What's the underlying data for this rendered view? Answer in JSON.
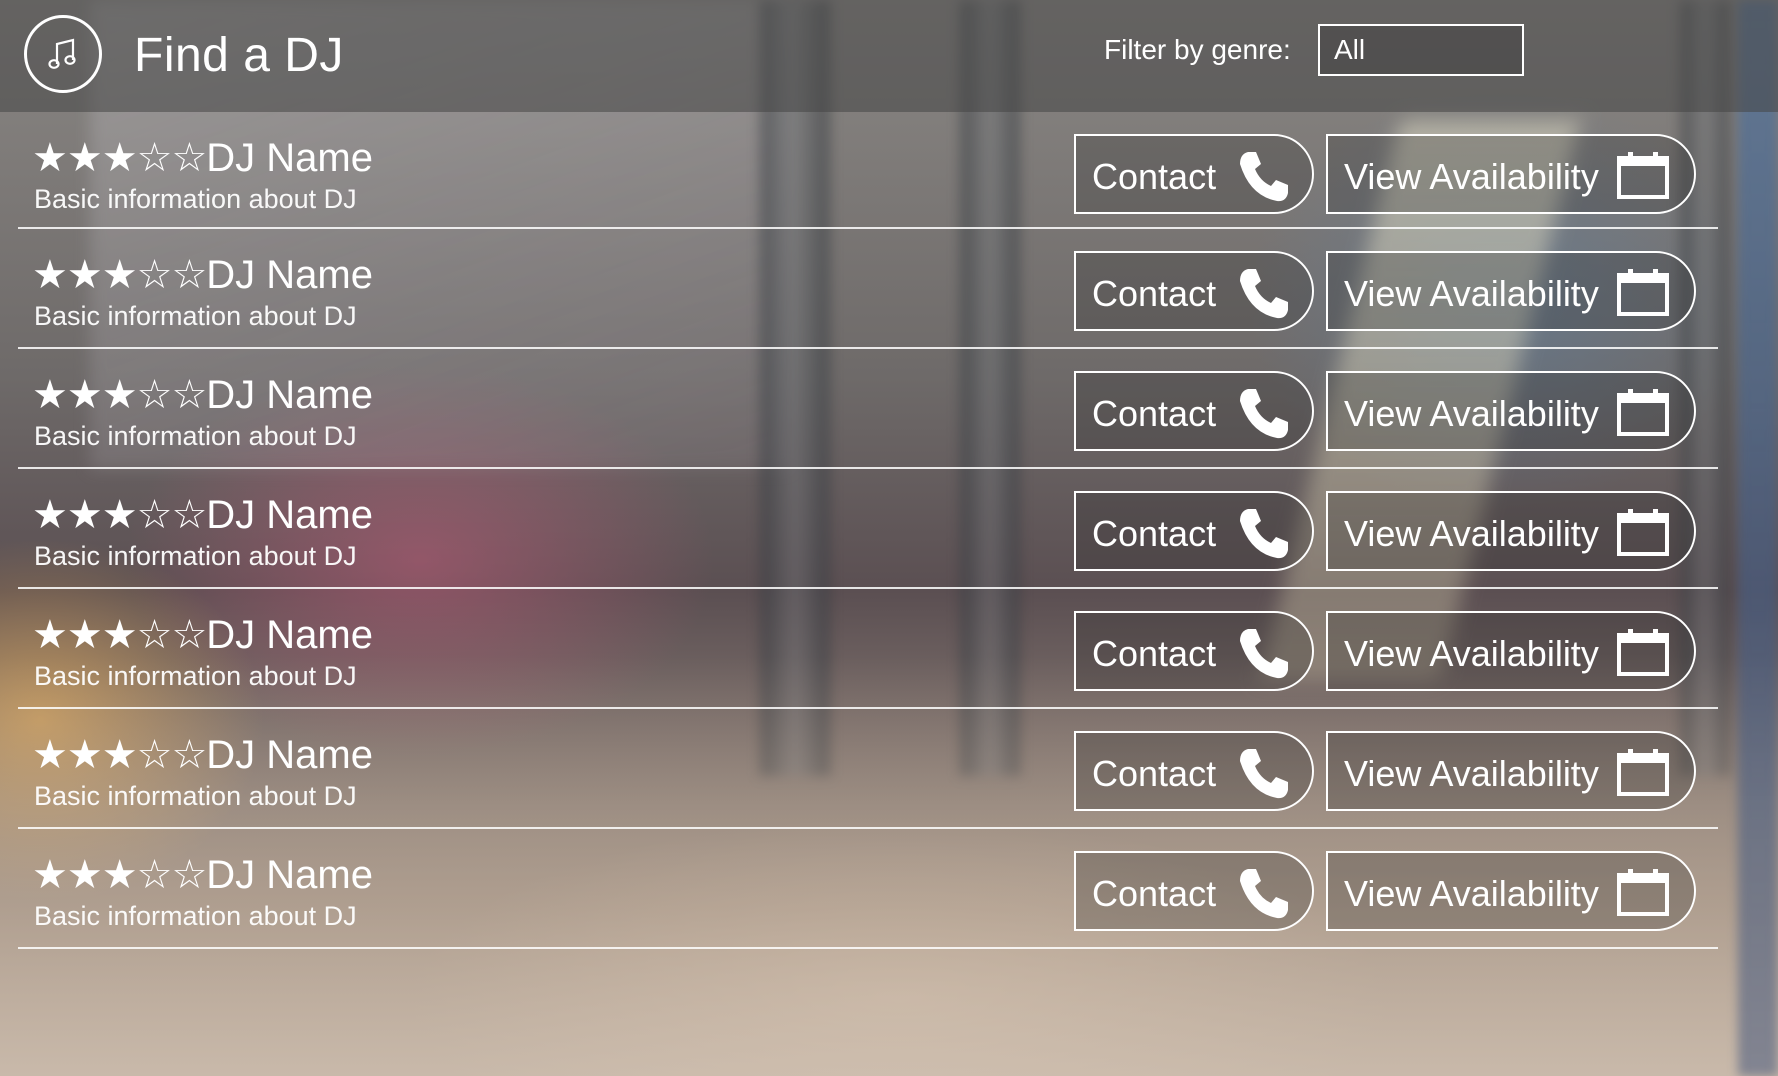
{
  "header": {
    "title": "Find a DJ",
    "logo_icon": "music-note-icon",
    "filter_label": "Filter by genre:",
    "filter_value": "All"
  },
  "djs": [
    {
      "rating_stars": "★★★☆☆",
      "rating": 3,
      "name": "DJ Name",
      "info": "Basic information about DJ",
      "contact_label": "Contact",
      "availability_label": "View Availability"
    },
    {
      "rating_stars": "★★★☆☆",
      "rating": 3,
      "name": "DJ Name",
      "info": "Basic information about DJ",
      "contact_label": "Contact",
      "availability_label": "View Availability"
    },
    {
      "rating_stars": "★★★☆☆",
      "rating": 3,
      "name": "DJ Name",
      "info": "Basic information about DJ",
      "contact_label": "Contact",
      "availability_label": "View Availability"
    },
    {
      "rating_stars": "★★★☆☆",
      "rating": 3,
      "name": "DJ Name",
      "info": "Basic information about DJ",
      "contact_label": "Contact",
      "availability_label": "View Availability"
    },
    {
      "rating_stars": "★★★☆☆",
      "rating": 3,
      "name": "DJ Name",
      "info": "Basic information about DJ",
      "contact_label": "Contact",
      "availability_label": "View Availability"
    },
    {
      "rating_stars": "★★★☆☆",
      "rating": 3,
      "name": "DJ Name",
      "info": "Basic information about DJ",
      "contact_label": "Contact",
      "availability_label": "View Availability"
    },
    {
      "rating_stars": "★★★☆☆",
      "rating": 3,
      "name": "DJ Name",
      "info": "Basic information about DJ",
      "contact_label": "Contact",
      "availability_label": "View Availability"
    }
  ],
  "icons": {
    "contact": "phone-icon",
    "availability": "calendar-icon"
  },
  "colors": {
    "foreground": "#ffffff",
    "header_overlay": "#464646"
  }
}
